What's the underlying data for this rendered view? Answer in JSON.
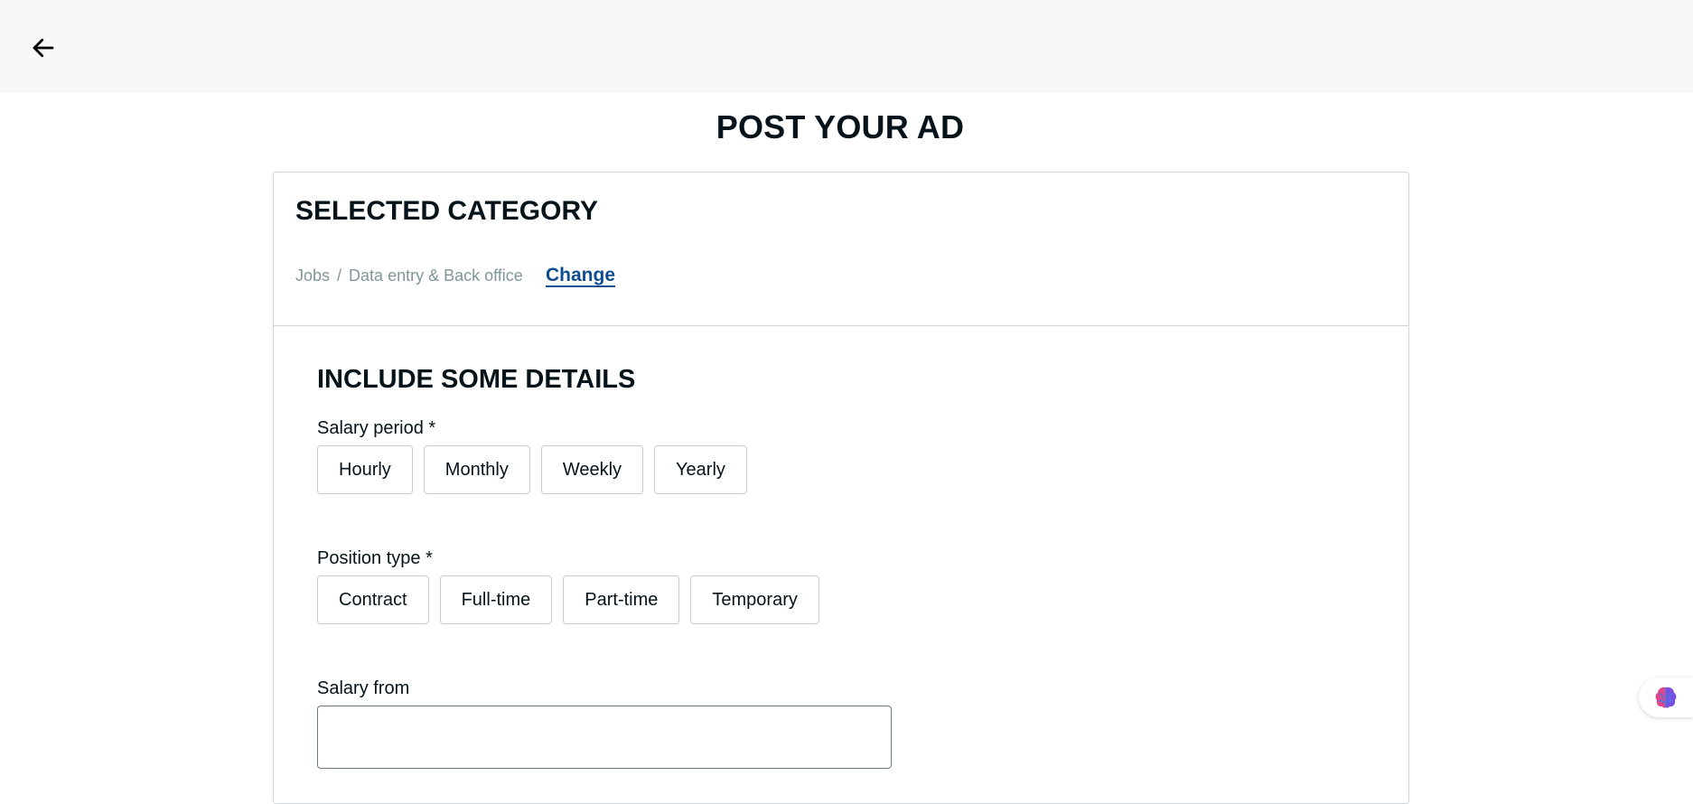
{
  "header": {
    "back_icon": "arrow-left-icon"
  },
  "page": {
    "title": "POST YOUR AD"
  },
  "category": {
    "title": "SELECTED CATEGORY",
    "breadcrumb": [
      "Jobs",
      "Data entry & Back office"
    ],
    "separator": "/",
    "change_label": "Change"
  },
  "details": {
    "title": "INCLUDE SOME DETAILS",
    "salary_period": {
      "label": "Salary period *",
      "options": [
        "Hourly",
        "Monthly",
        "Weekly",
        "Yearly"
      ]
    },
    "position_type": {
      "label": "Position type *",
      "options": [
        "Contract",
        "Full-time",
        "Part-time",
        "Temporary"
      ]
    },
    "salary_from": {
      "label": "Salary from",
      "value": ""
    }
  },
  "assistant": {
    "icon": "brain-icon",
    "colors": [
      "#e0458c",
      "#7b4de0",
      "#3f7be6"
    ]
  }
}
